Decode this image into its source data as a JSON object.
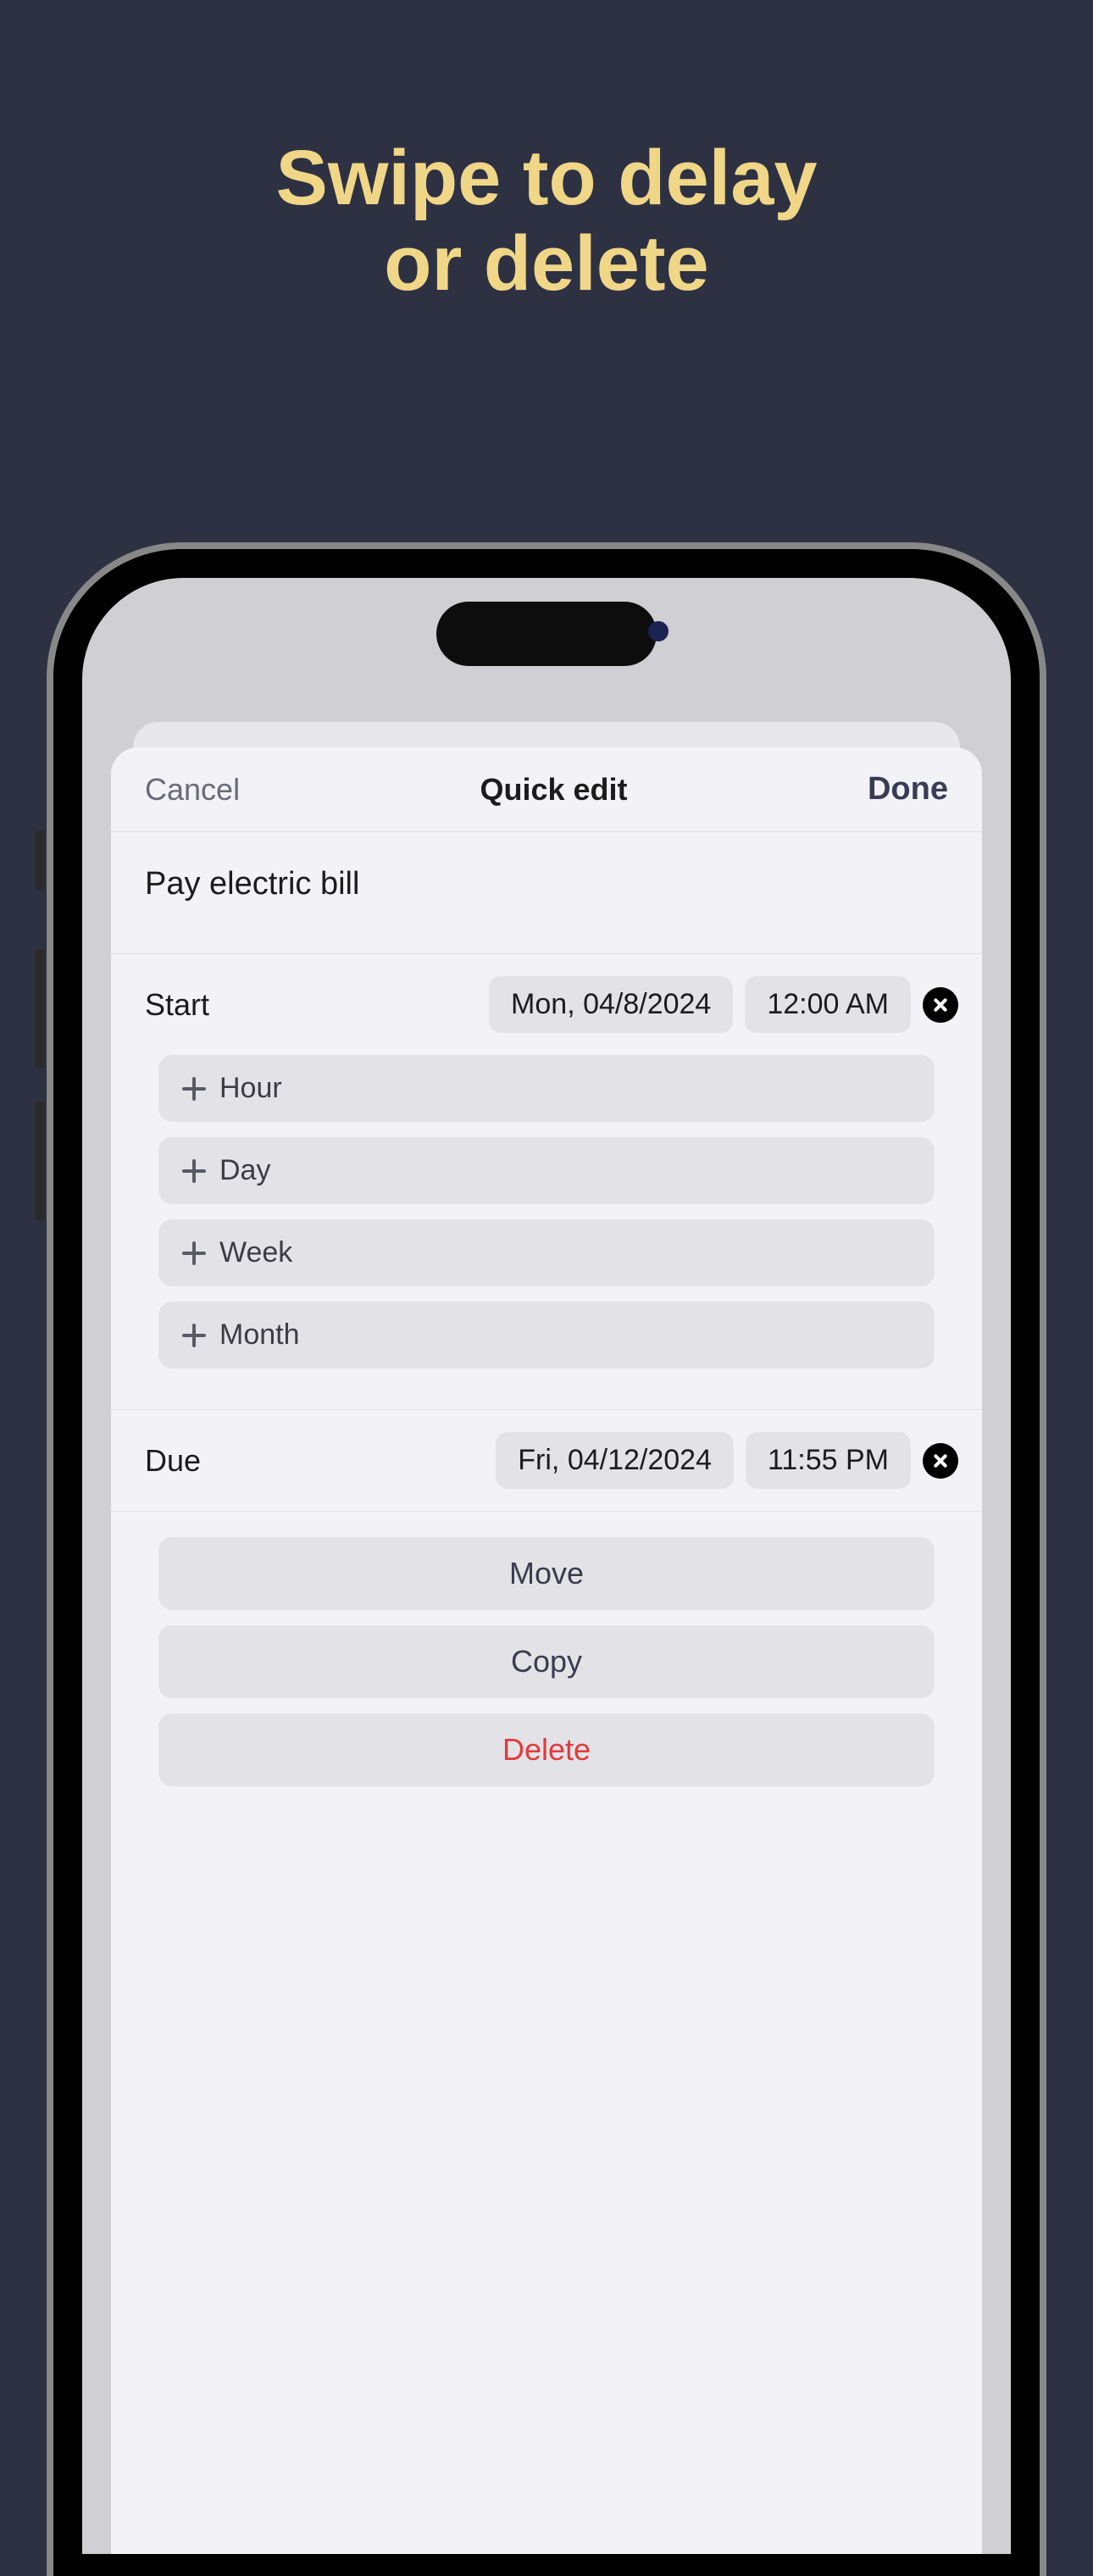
{
  "promo": {
    "line1": "Swipe to delay",
    "line2": "or delete"
  },
  "modal": {
    "cancel": "Cancel",
    "title": "Quick edit",
    "done": "Done",
    "task_title": "Pay electric bill",
    "start": {
      "label": "Start",
      "date": "Mon, 04/8/2024",
      "time": "12:00 AM"
    },
    "add_buttons": [
      "Hour",
      "Day",
      "Week",
      "Month"
    ],
    "due": {
      "label": "Due",
      "date": "Fri, 04/12/2024",
      "time": "11:55 PM"
    },
    "actions": {
      "move": "Move",
      "copy": "Copy",
      "delete": "Delete"
    }
  }
}
